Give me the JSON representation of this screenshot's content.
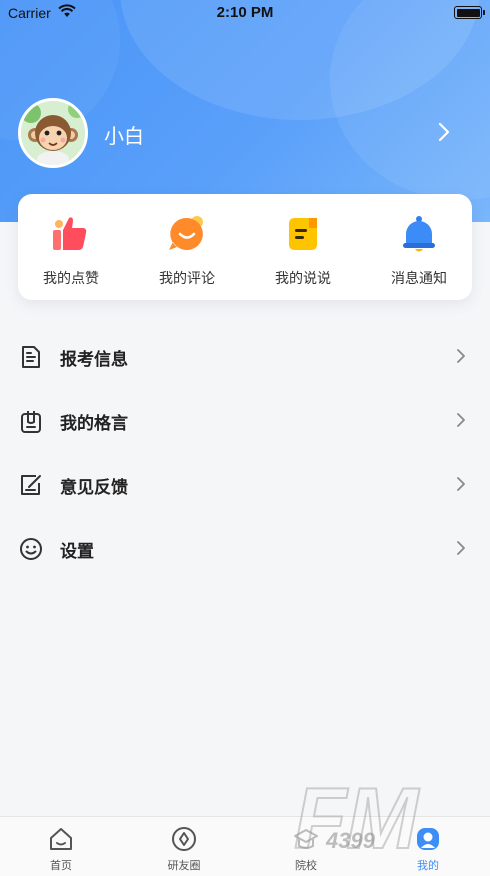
{
  "status_bar": {
    "carrier": "Carrier",
    "time": "2:10 PM"
  },
  "profile": {
    "username": "小白"
  },
  "quick_actions": [
    {
      "label": "我的点赞",
      "icon": "thumbs-up-icon"
    },
    {
      "label": "我的评论",
      "icon": "comment-bubble-icon"
    },
    {
      "label": "我的说说",
      "icon": "note-icon"
    },
    {
      "label": "消息通知",
      "icon": "bell-icon"
    }
  ],
  "menu": [
    {
      "label": "报考信息",
      "icon": "document-icon"
    },
    {
      "label": "我的格言",
      "icon": "clipboard-icon"
    },
    {
      "label": "意见反馈",
      "icon": "edit-icon"
    },
    {
      "label": "设置",
      "icon": "smiley-icon"
    }
  ],
  "tabbar": [
    {
      "label": "首页",
      "icon": "home-icon"
    },
    {
      "label": "研友圈",
      "icon": "circle-icon"
    },
    {
      "label": "院校",
      "icon": "school-icon"
    },
    {
      "label": "我的",
      "icon": "profile-icon"
    }
  ],
  "colors": {
    "accent": "#3e8ef7",
    "header_blue": "#4a95f7"
  },
  "watermark": {
    "text": "FM",
    "subtext": "4399"
  }
}
